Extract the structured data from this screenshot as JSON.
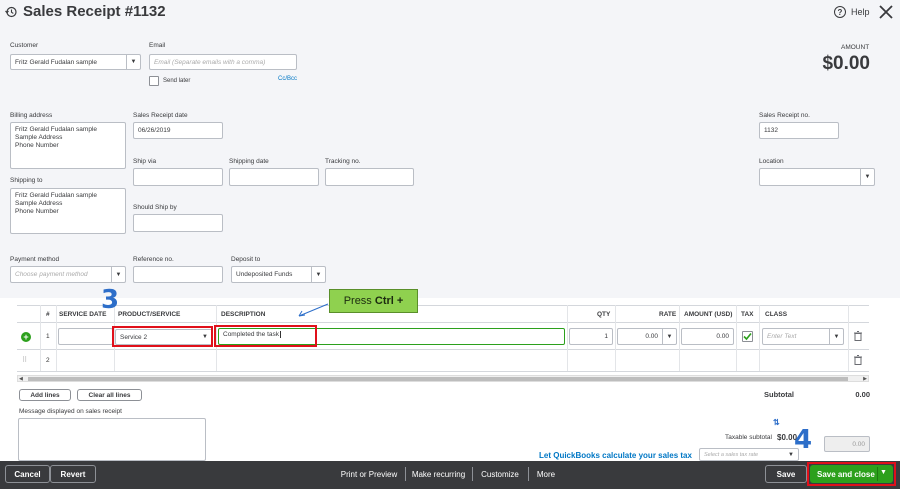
{
  "header": {
    "title": "Sales Receipt #1132",
    "help_label": "Help"
  },
  "form": {
    "customer_label": "Customer",
    "customer_value": "Fritz Gerald Fudalan sample",
    "email_label": "Email",
    "email_placeholder": "Email (Separate emails with a comma)",
    "send_later_label": "Send later",
    "cc_bcc_label": "Cc/Bcc",
    "amount_label": "AMOUNT",
    "amount_value": "$0.00",
    "billing_address_label": "Billing address",
    "billing_address_lines": [
      "Fritz Gerald Fudalan sample",
      "Sample Address",
      "Phone Number"
    ],
    "sales_receipt_date_label": "Sales Receipt date",
    "sales_receipt_date_value": "06/26/2019",
    "sales_receipt_no_label": "Sales Receipt no.",
    "sales_receipt_no_value": "1132",
    "ship_via_label": "Ship via",
    "shipping_date_label": "Shipping date",
    "tracking_no_label": "Tracking no.",
    "location_label": "Location",
    "shipping_to_label": "Shipping to",
    "shipping_to_lines": [
      "Fritz Gerald Fudalan sample",
      "Sample Address",
      "Phone Number"
    ],
    "should_ship_by_label": "Should Ship by",
    "payment_method_label": "Payment method",
    "payment_method_placeholder": "Choose payment method",
    "reference_no_label": "Reference no.",
    "deposit_to_label": "Deposit to",
    "deposit_to_value": "Undeposited Funds"
  },
  "table": {
    "headers": {
      "num": "#",
      "service_date": "SERVICE DATE",
      "product_service": "PRODUCT/SERVICE",
      "description": "DESCRIPTION",
      "qty": "QTY",
      "rate": "RATE",
      "amount": "AMOUNT (USD)",
      "tax": "TAX",
      "class": "CLASS"
    },
    "rows": [
      {
        "num": "1",
        "product": "Service 2",
        "description": "Completed the task",
        "qty": "1",
        "rate": "0.00",
        "amount": "0.00",
        "class_placeholder": "Enter Text"
      },
      {
        "num": "2"
      }
    ],
    "add_lines_label": "Add lines",
    "clear_all_lines_label": "Clear all lines"
  },
  "totals": {
    "subtotal_label": "Subtotal",
    "subtotal_value": "0.00",
    "taxable_subtotal_label": "Taxable subtotal",
    "taxable_subtotal_value": "$0.00",
    "let_qb_label": "Let QuickBooks calculate your sales tax",
    "sales_tax_placeholder": "Select a sales tax rate",
    "tax_amount_value": "0.00"
  },
  "message": {
    "label": "Message displayed on sales receipt"
  },
  "annotations": {
    "step3": "3",
    "step4": "4",
    "callout_text": "Press",
    "callout_key": "Ctrl +"
  },
  "footer": {
    "cancel_label": "Cancel",
    "revert_label": "Revert",
    "print_label": "Print or Preview",
    "recurring_label": "Make recurring",
    "customize_label": "Customize",
    "more_label": "More",
    "save_label": "Save",
    "save_close_label": "Save and close"
  },
  "colors": {
    "green": "#2ca01c",
    "annotation_red": "#e0101a",
    "annotation_blue": "#2d6ec9",
    "callout_green": "#8fd14f",
    "footer_bg": "#393a3d",
    "link_blue": "#0077c5"
  }
}
